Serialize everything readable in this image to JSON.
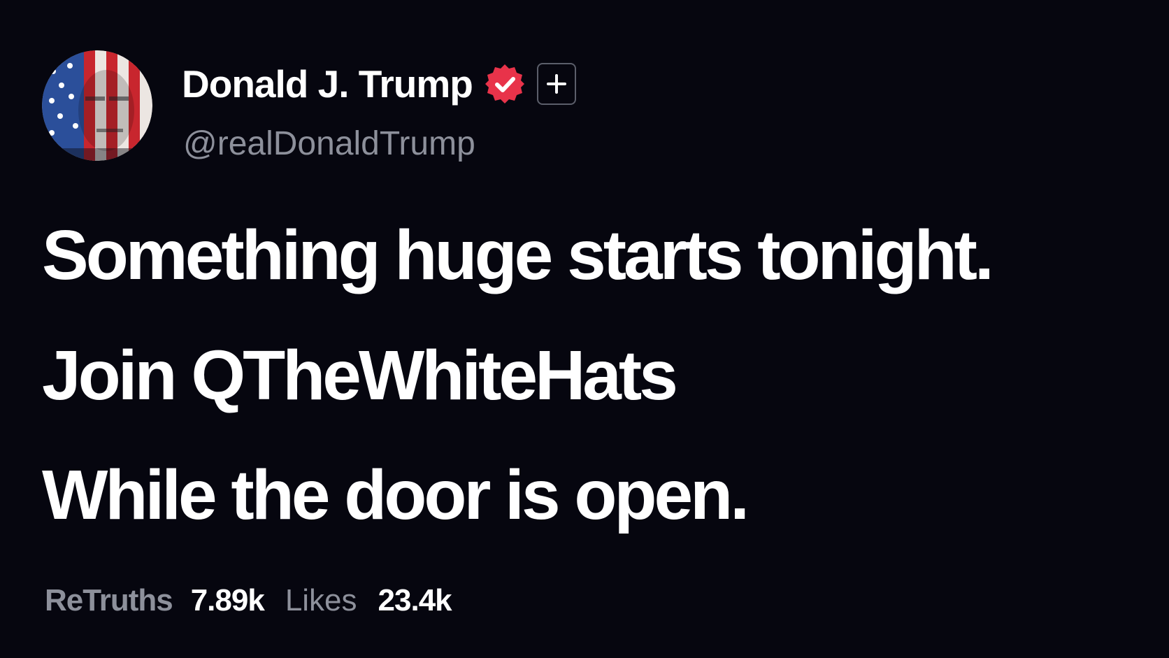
{
  "author": {
    "display_name": "Donald J. Trump",
    "handle": "@realDonaldTrump",
    "verified_icon": "verified-badge-icon",
    "follow_icon": "plus-icon"
  },
  "post": {
    "lines": [
      "Something huge starts tonight.",
      "Join QTheWhiteHats",
      "While the door is open."
    ]
  },
  "stats": {
    "retruths_label": "ReTruths",
    "retruths_value": "7.89k",
    "likes_label": "Likes",
    "likes_value": "23.4k"
  },
  "colors": {
    "background": "#06060f",
    "text_primary": "#ffffff",
    "text_secondary": "#8d909b",
    "verified_badge": "#e8334a",
    "button_border": "#5b5e6a"
  }
}
